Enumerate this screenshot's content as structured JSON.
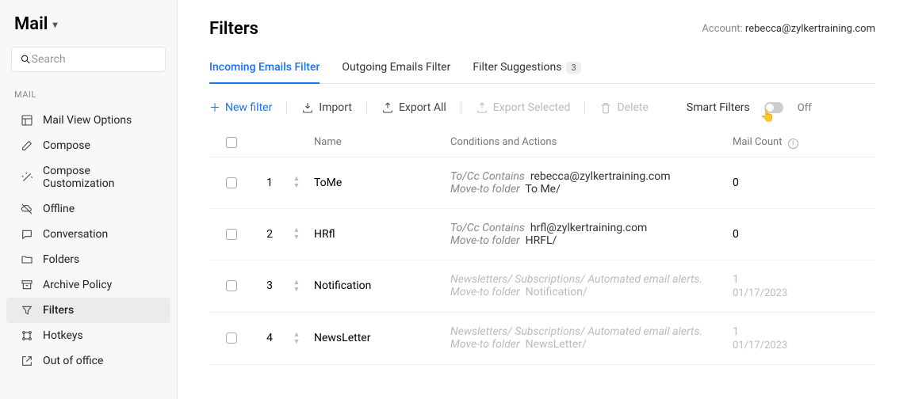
{
  "app": {
    "name": "Mail"
  },
  "search": {
    "placeholder": "Search"
  },
  "section_label": "MAIL",
  "nav": [
    {
      "id": "mail-view-options",
      "label": "Mail View Options",
      "icon": "layout"
    },
    {
      "id": "compose",
      "label": "Compose",
      "icon": "edit"
    },
    {
      "id": "compose-customization",
      "label": "Compose Customization",
      "icon": "wand"
    },
    {
      "id": "offline",
      "label": "Offline",
      "icon": "cloud-off"
    },
    {
      "id": "conversation",
      "label": "Conversation",
      "icon": "chat"
    },
    {
      "id": "folders",
      "label": "Folders",
      "icon": "folder"
    },
    {
      "id": "archive-policy",
      "label": "Archive Policy",
      "icon": "archive"
    },
    {
      "id": "filters",
      "label": "Filters",
      "icon": "filter",
      "active": true
    },
    {
      "id": "hotkeys",
      "label": "Hotkeys",
      "icon": "keyboard"
    },
    {
      "id": "out-of-office",
      "label": "Out of office",
      "icon": "arrow-out"
    }
  ],
  "page": {
    "title": "Filters",
    "account_label": "Account:",
    "account_email": "rebecca@zylkertraining.com"
  },
  "tabs": [
    {
      "id": "incoming",
      "label": "Incoming Emails Filter",
      "active": true
    },
    {
      "id": "outgoing",
      "label": "Outgoing Emails Filter"
    },
    {
      "id": "suggestions",
      "label": "Filter Suggestions",
      "badge": "3"
    }
  ],
  "toolbar": {
    "new_filter": "New filter",
    "import": "Import",
    "export_all": "Export All",
    "export_selected": "Export Selected",
    "delete": "Delete",
    "smart_filters": "Smart Filters",
    "smart_state": "Off"
  },
  "columns": {
    "name": "Name",
    "conditions": "Conditions and Actions",
    "mail_count": "Mail Count"
  },
  "rows": [
    {
      "order": "1",
      "name": "ToMe",
      "cond_prefix": "To/Cc Contains",
      "cond_value": "rebecca@zylkertraining.com",
      "action_prefix": "Move-to folder",
      "action_value": "To Me/",
      "count": "0",
      "date": ""
    },
    {
      "order": "2",
      "name": "HRfl",
      "cond_prefix": "To/Cc Contains",
      "cond_value": "hrfl@zylkertraining.com",
      "action_prefix": "Move-to folder",
      "action_value": "HRFL/",
      "count": "0",
      "date": ""
    },
    {
      "order": "3",
      "name": "Notification",
      "cond_prefix": "",
      "cond_value": "Newsletters/ Subscriptions/ Automated email alerts.",
      "action_prefix": "Move-to folder",
      "action_value": "Notification/",
      "count": "1",
      "date": "01/17/2023",
      "faded": true
    },
    {
      "order": "4",
      "name": "NewsLetter",
      "cond_prefix": "",
      "cond_value": "Newsletters/ Subscriptions/ Automated email alerts.",
      "action_prefix": "Move-to folder",
      "action_value": "NewsLetter/",
      "count": "1",
      "date": "01/17/2023",
      "faded": true
    }
  ]
}
